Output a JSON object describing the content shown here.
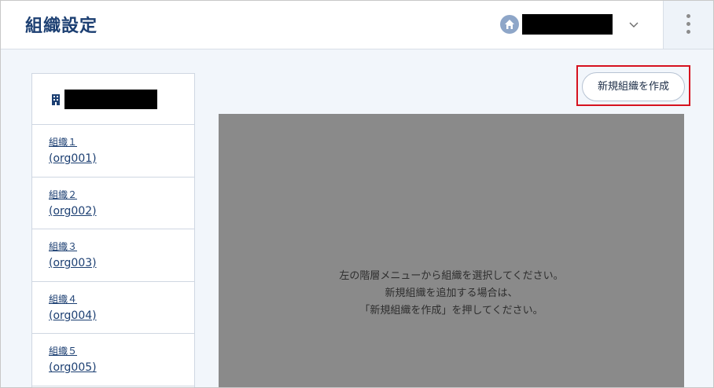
{
  "header": {
    "title": "組織設定",
    "tenant_name": "",
    "icons": [
      "home-icon",
      "chevron-down-icon",
      "kebab-menu-icon"
    ]
  },
  "sidebar": {
    "root_name": "",
    "root_icon": "building-icon",
    "items": [
      {
        "name": "組織１",
        "code": "(org001)"
      },
      {
        "name": "組織２",
        "code": "(org002)"
      },
      {
        "name": "組織３",
        "code": "(org003)"
      },
      {
        "name": "組織４",
        "code": "(org004)"
      },
      {
        "name": "組織５",
        "code": "(org005)"
      }
    ]
  },
  "main": {
    "create_button_label": "新規組織を作成",
    "guide_lines": [
      "左の階層メニューから組織を選択してください。",
      "新規組織を追加する場合は、",
      "「新規組織を作成」を押してください。"
    ]
  },
  "colors": {
    "title": "#1c3f72",
    "highlight": "#d6121f",
    "panel": "#8a8a8a",
    "background": "#f2f6fb"
  }
}
